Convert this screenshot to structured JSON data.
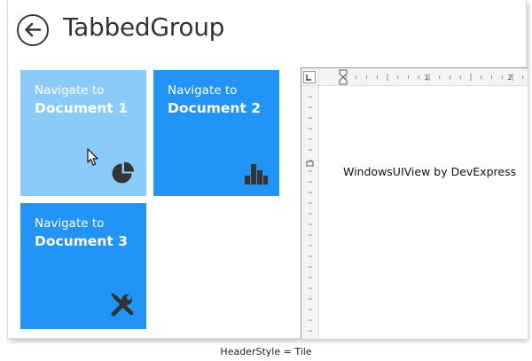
{
  "header": {
    "title": "TabbedGroup",
    "back_icon": "arrow-left-circle-icon"
  },
  "tiles": [
    {
      "nav_label": "Navigate to",
      "doc_label": "Document 1",
      "color": "#8acbfa",
      "icon": "pie-chart-icon"
    },
    {
      "nav_label": "Navigate to",
      "doc_label": "Document 2",
      "color": "#2294f7",
      "icon": "bar-chart-icon"
    },
    {
      "nav_label": "Navigate to",
      "doc_label": "Document 3",
      "color": "#2294f7",
      "icon": "tools-icon"
    }
  ],
  "document": {
    "content": "WindowsUIView by DevExpress",
    "ruler_numbers": [
      "1",
      "2"
    ]
  },
  "caption": "HeaderStyle = Tile"
}
